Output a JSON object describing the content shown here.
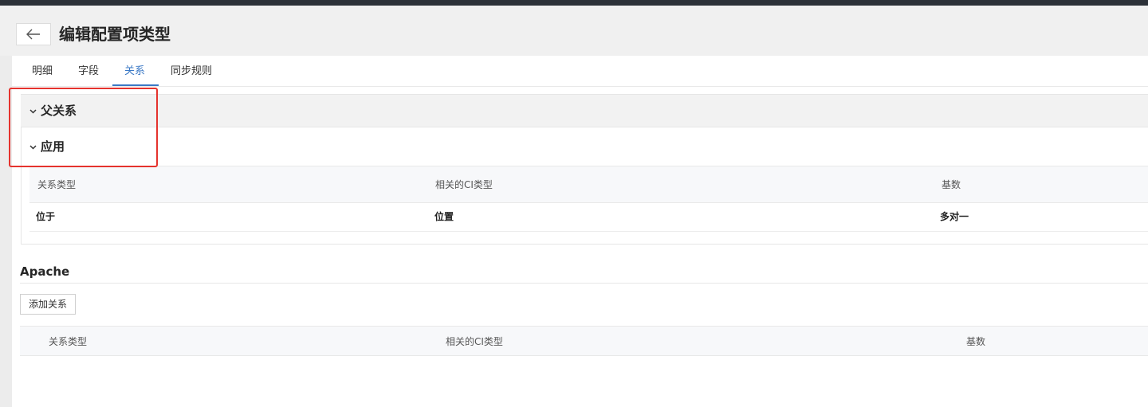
{
  "header": {
    "title": "编辑配置项类型"
  },
  "tabs": [
    {
      "label": "明细",
      "active": false
    },
    {
      "label": "字段",
      "active": false
    },
    {
      "label": "关系",
      "active": true
    },
    {
      "label": "同步规则",
      "active": false
    }
  ],
  "parent_group": {
    "label": "父关系"
  },
  "app_group": {
    "label": "应用",
    "columns": [
      "关系类型",
      "相关的CI类型",
      "基数"
    ],
    "rows": [
      {
        "type": "位于",
        "ci_type": "位置",
        "cardinality": "多对一"
      }
    ]
  },
  "apache": {
    "title": "Apache",
    "add_button": "添加关系",
    "columns": [
      "关系类型",
      "相关的CI类型",
      "基数"
    ]
  },
  "colors": {
    "accent": "#3a78c5",
    "highlight": "#e5332e",
    "topbar": "#2c3138"
  },
  "icons": {
    "back": "arrow-left-icon",
    "collapse": "chevron-down-icon"
  }
}
